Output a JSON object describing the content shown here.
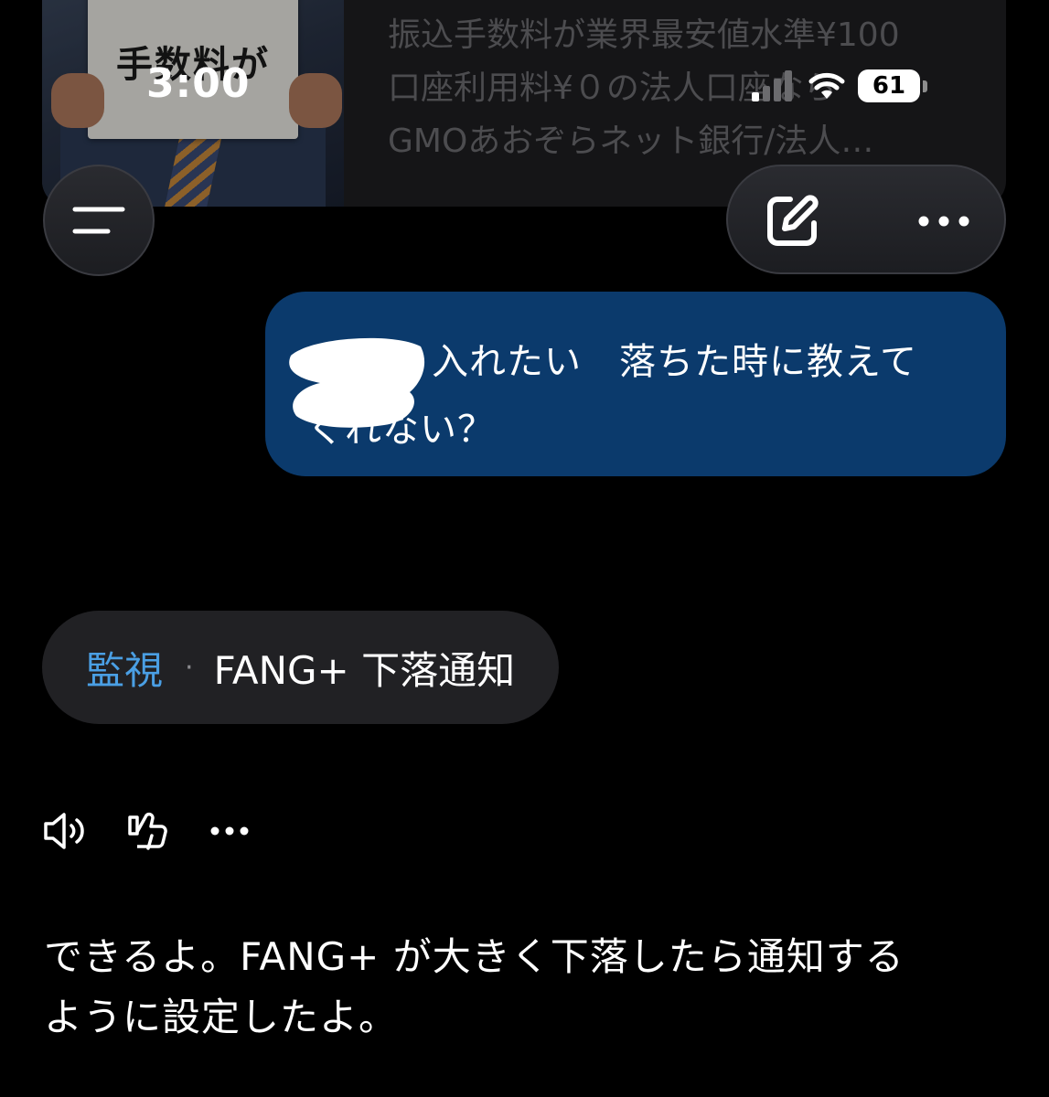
{
  "status_bar": {
    "time": "3:00",
    "battery": "61"
  },
  "ad": {
    "sign_text": "手数料が",
    "lines": [
      "振込手数料が業界最安値水準¥100",
      "口座利用料¥０の法人口座なら",
      "GMOあおぞらネット銀行/法人…"
    ]
  },
  "nav": {
    "menu_icon": "menu-icon",
    "edit_icon": "compose-icon",
    "more_icon": "more-horizontal-icon"
  },
  "user_message": {
    "line1": "入れたい　落ちた時に教えて",
    "line2": "くれない？"
  },
  "tool_chip": {
    "category": "監視",
    "separator": "·",
    "title": "FANG+ 下落通知"
  },
  "actions": {
    "icons": [
      "speaker-icon",
      "thumbs-down-icon",
      "more-horizontal-icon"
    ]
  },
  "assistant_message": {
    "line1": "できるよ。FANG+ が大きく下落したら通知する",
    "line2": "ように設定したよ。"
  },
  "colors": {
    "background": "#000000",
    "user_bubble": "#0b3a6c",
    "chip_background": "#212124",
    "chip_accent": "#4a9fe4"
  }
}
